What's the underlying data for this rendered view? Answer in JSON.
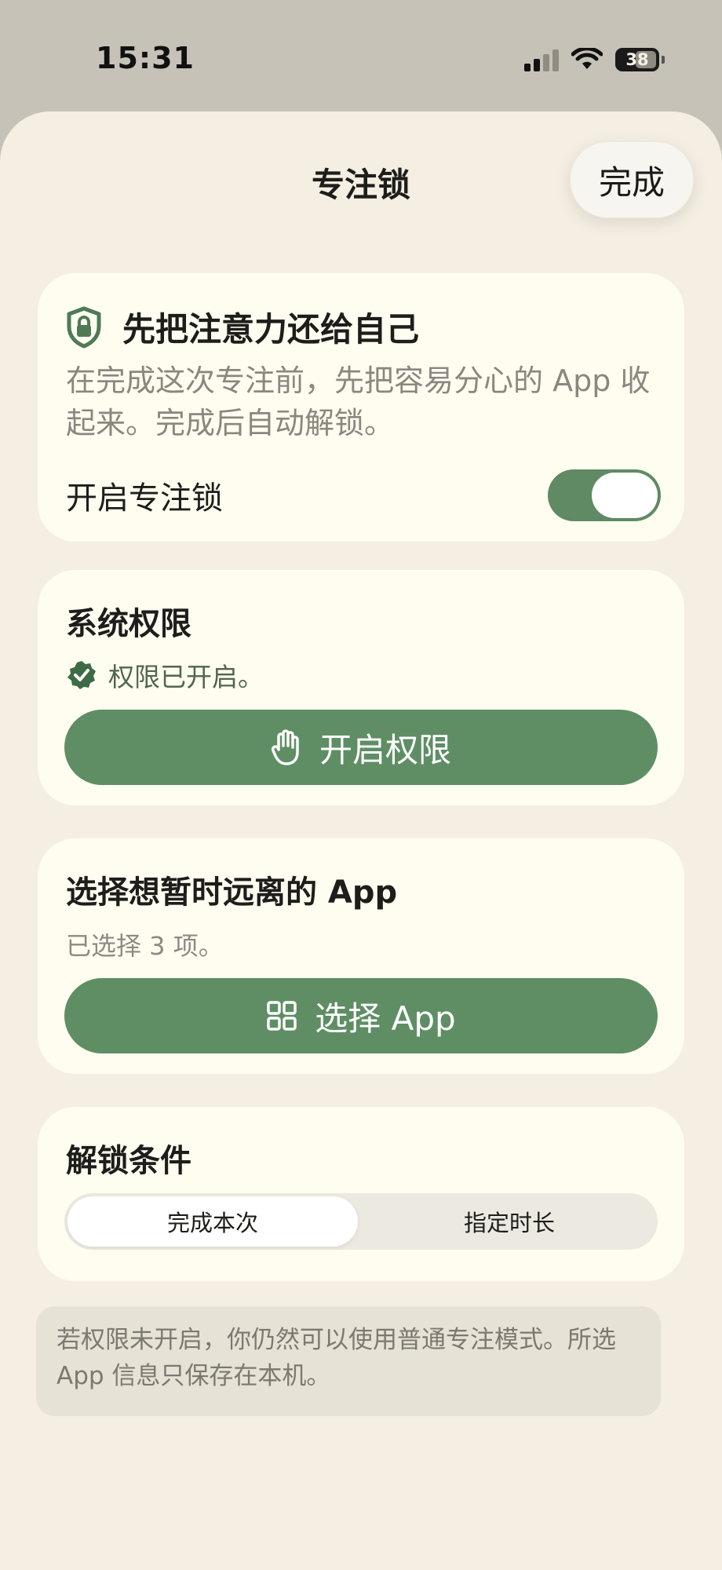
{
  "status_bar": {
    "time": "15:31",
    "battery": "38"
  },
  "header": {
    "title": "专注锁",
    "done_label": "完成"
  },
  "focus_card": {
    "title": "先把注意力还给自己",
    "description": "在完成这次专注前，先把容易分心的 App 收起来。完成后自动解锁。",
    "toggle_label": "开启专注锁",
    "toggle_on": true
  },
  "permission_card": {
    "title": "系统权限",
    "status": "权限已开启。",
    "button_label": "开启权限"
  },
  "apps_card": {
    "title": "选择想暂时远离的 App",
    "selected_text": "已选择 3 项。",
    "button_label": "选择 App"
  },
  "unlock_card": {
    "title": "解锁条件",
    "options": [
      "完成本次",
      "指定时长"
    ],
    "selected": "完成本次"
  },
  "note": "若权限未开启，你仍然可以使用普通专注模式。所选 App 信息只保存在本机。",
  "colors": {
    "accent_green": "#5f8e65",
    "sheet_background": "#f5eee2",
    "card_background": "#fffcf0"
  },
  "icons": [
    "cellular-signal-icon",
    "wifi-icon",
    "battery-icon",
    "shield-lock-icon",
    "verified-check-icon",
    "hand-icon",
    "grid-apps-icon"
  ]
}
